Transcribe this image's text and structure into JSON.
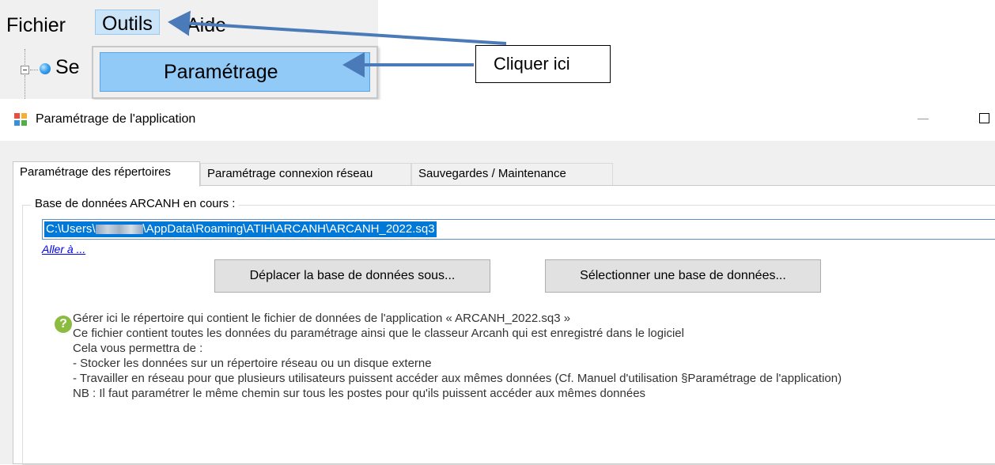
{
  "menu": {
    "items": [
      {
        "label": "Fichier"
      },
      {
        "label": "Outils"
      },
      {
        "label": "Aide"
      }
    ],
    "dropdown_item": "Paramétrage"
  },
  "tree": {
    "label_fragment": "Se"
  },
  "annotation": {
    "callout": "Cliquer ici",
    "arrow_color": "#4a7ab8"
  },
  "window": {
    "title": "Paramétrage de l'application",
    "tabs": [
      {
        "label": "Paramétrage des répertoires",
        "active": true
      },
      {
        "label": "Paramétrage connexion réseau",
        "active": false
      },
      {
        "label": "Sauvegardes / Maintenance",
        "active": false
      }
    ],
    "group_title": "Base de données ARCANH en cours :",
    "path_prefix": "C:\\Users\\",
    "path_suffix": "\\AppData\\Roaming\\ATIH\\ARCANH\\ARCANH_2022.sq3",
    "goto_link": "Aller à ...",
    "buttons": {
      "move": "Déplacer la base de données sous...",
      "select": "Sélectionner une base de données..."
    },
    "help_lines": [
      "Gérer ici le répertoire qui contient le fichier de données de l'application « ARCANH_2022.sq3 »",
      "Ce fichier contient toutes les données du paramétrage ainsi que le classeur Arcanh qui est enregistré dans le logiciel",
      "Cela vous permettra de :",
      " - Stocker les données sur un répertoire réseau ou un disque externe",
      " - Travailler en réseau pour que plusieurs utilisateurs puissent accéder aux mêmes données (Cf. Manuel d'utilisation §Paramétrage de l'application)",
      "NB : Il faut paramétrer le même chemin sur tous les postes pour qu'ils puissent accéder aux mêmes données"
    ],
    "help_icon": "?"
  }
}
